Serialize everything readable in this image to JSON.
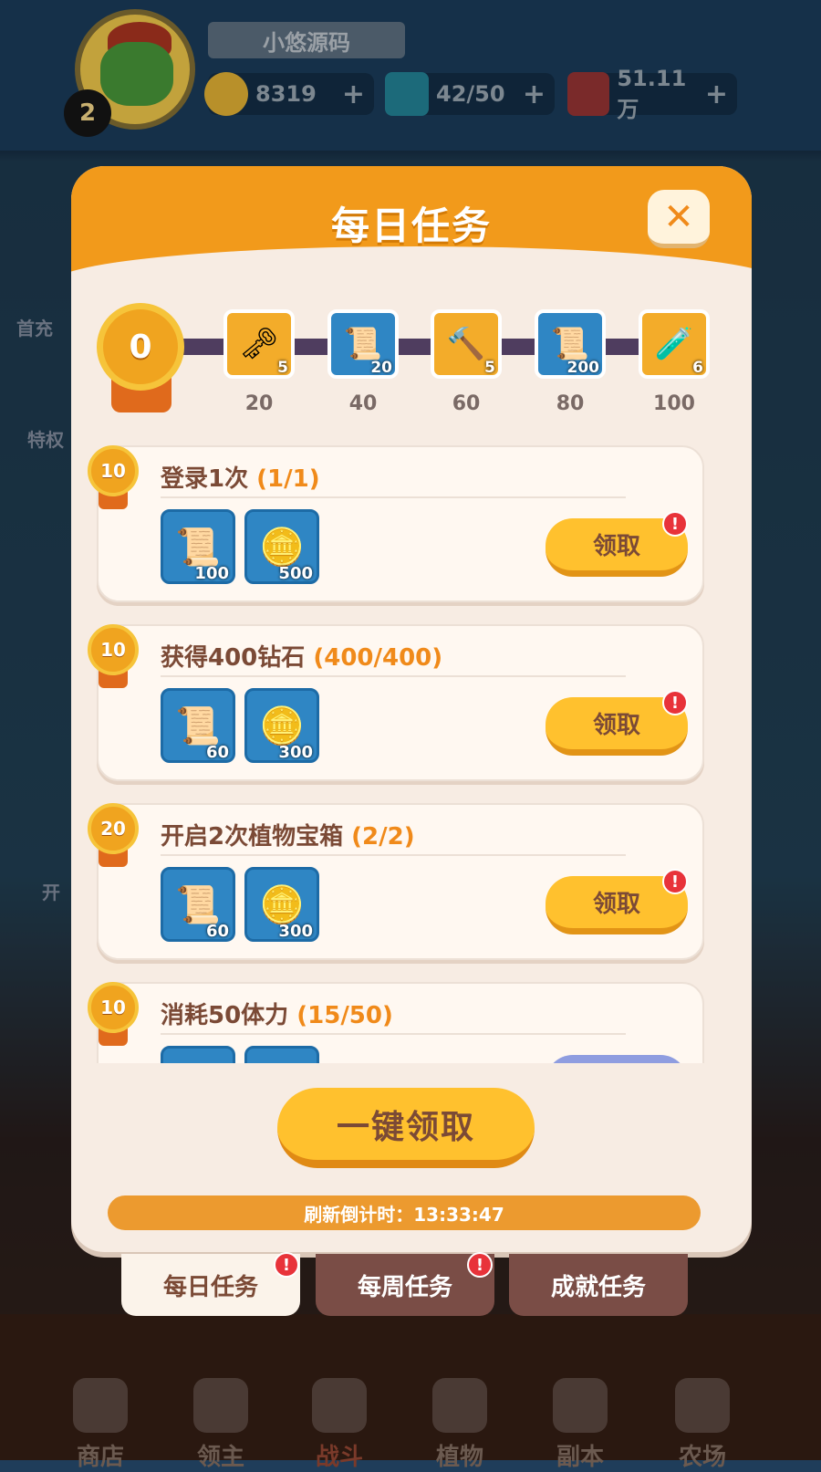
{
  "player": {
    "name": "小悠源码",
    "level": "2"
  },
  "resources": [
    {
      "name": "coin",
      "value": "8319"
    },
    {
      "name": "energy",
      "value": "42/50"
    },
    {
      "name": "gem",
      "value": "51.11万"
    }
  ],
  "side_labels": [
    "首充",
    "特权",
    "开"
  ],
  "modal": {
    "title": "每日任务",
    "current_points": "0",
    "milestones": [
      {
        "points": "20",
        "count": "5",
        "icon": "key-icon"
      },
      {
        "points": "40",
        "count": "20",
        "icon": "scroll-icon"
      },
      {
        "points": "60",
        "count": "5",
        "icon": "hammer-icon"
      },
      {
        "points": "80",
        "count": "200",
        "icon": "scroll-icon"
      },
      {
        "points": "100",
        "count": "6",
        "icon": "potion-icon"
      }
    ],
    "tasks": [
      {
        "points": "10",
        "title": "登录1次",
        "progress": "(1/1)",
        "rewards": [
          {
            "icon": "scroll-icon",
            "count": "100"
          },
          {
            "icon": "coin-icon",
            "count": "500"
          }
        ],
        "button": "领取",
        "alert": "!"
      },
      {
        "points": "10",
        "title": "获得400钻石",
        "progress": "(400/400)",
        "rewards": [
          {
            "icon": "scroll-icon",
            "count": "60"
          },
          {
            "icon": "coin-icon",
            "count": "300"
          }
        ],
        "button": "领取",
        "alert": "!"
      },
      {
        "points": "20",
        "title": "开启2次植物宝箱",
        "progress": "(2/2)",
        "rewards": [
          {
            "icon": "scroll-icon",
            "count": "60"
          },
          {
            "icon": "coin-icon",
            "count": "300"
          }
        ],
        "button": "领取",
        "alert": "!"
      },
      {
        "points": "10",
        "title": "消耗50体力",
        "progress": "(15/50)",
        "rewards": [
          {
            "icon": "scroll-icon",
            "count": ""
          },
          {
            "icon": "coin-icon",
            "count": ""
          }
        ],
        "button": ""
      }
    ],
    "claim_all": "一键领取",
    "refresh_label": "刷新倒计时：13:33:47"
  },
  "tabs": [
    {
      "label": "每日任务",
      "alert": "!"
    },
    {
      "label": "每周任务",
      "alert": "!"
    },
    {
      "label": "成就任务"
    }
  ],
  "nav": [
    {
      "label": "商店"
    },
    {
      "label": "领主"
    },
    {
      "label": "战斗"
    },
    {
      "label": "植物"
    },
    {
      "label": "副本"
    },
    {
      "label": "农场"
    }
  ],
  "colors": {
    "accent": "#f29a1b",
    "button": "#ffc12e",
    "badge": "#e8333a",
    "progress_text": "#f08a1a"
  }
}
